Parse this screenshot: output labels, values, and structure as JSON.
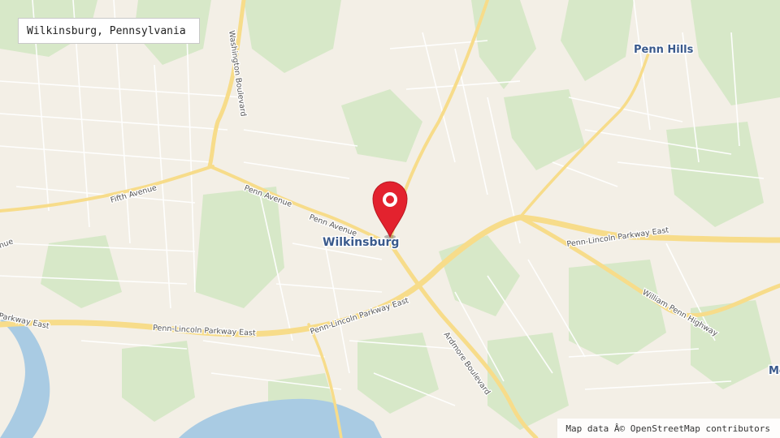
{
  "title": "Wilkinsburg, Pennsylvania",
  "attribution": "Map data Â© OpenStreetMap contributors",
  "colors": {
    "land": "#f3efe6",
    "park": "#d7e8c8",
    "water": "#a9cbe3",
    "street": "#ffffff",
    "major_road": "#f7dc8a",
    "marker": "#e3222e",
    "place_label": "#3a5a8c"
  },
  "marker": {
    "icon": "map-pin-icon",
    "location": "Wilkinsburg"
  },
  "places": {
    "wilkinsburg": "Wilkinsburg",
    "penn_hills": "Penn Hills",
    "edge": "Mo"
  },
  "roads": {
    "washington_blvd": "Washington Boulevard",
    "fifth_ave": "Fifth Avenue",
    "penn_ave_1": "Penn Avenue",
    "penn_ave_2": "Penn Avenue",
    "parkway_east_1": "Penn-Lincoln Parkway East",
    "parkway_east_2": "Penn-Lincoln Parkway East",
    "parkway_east_3": "Penn-Lincoln Parkway East",
    "parkway_east_left": "Parkway East",
    "william_penn_hwy": "William Penn Highway",
    "ardmore_blvd": "Ardmore Boulevard",
    "left_edge": "nue"
  }
}
